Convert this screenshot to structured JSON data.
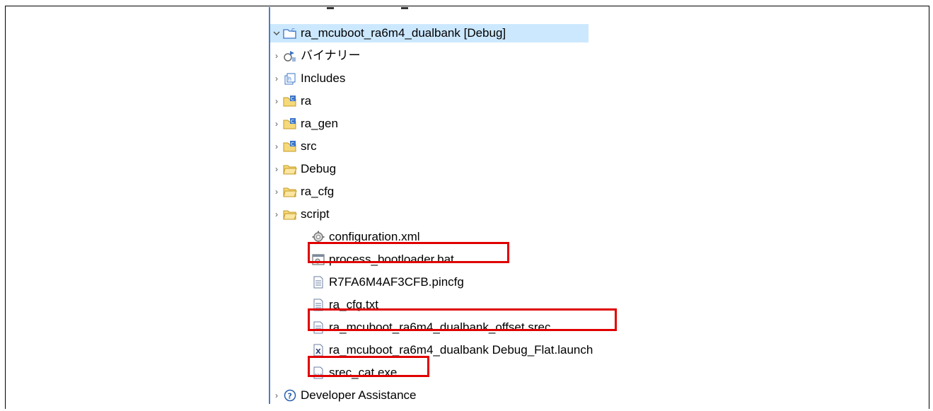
{
  "tree": {
    "root": {
      "label": "ra_mcuboot_ra6m4_dualbank [Debug]",
      "expanded": true,
      "icon": "project-folder-icon"
    },
    "items": [
      {
        "label": "バイナリー",
        "icon": "binaries-icon",
        "expandable": true
      },
      {
        "label": "Includes",
        "icon": "includes-icon",
        "expandable": true
      },
      {
        "label": "ra",
        "icon": "source-folder-icon",
        "expandable": true
      },
      {
        "label": "ra_gen",
        "icon": "source-folder-icon",
        "expandable": true
      },
      {
        "label": "src",
        "icon": "source-folder-icon",
        "expandable": true
      },
      {
        "label": "Debug",
        "icon": "folder-icon",
        "expandable": true
      },
      {
        "label": "ra_cfg",
        "icon": "folder-icon",
        "expandable": true
      },
      {
        "label": "script",
        "icon": "folder-icon",
        "expandable": true
      },
      {
        "label": "configuration.xml",
        "icon": "gear-file-icon",
        "expandable": false
      },
      {
        "label": "process_bootloader.bat",
        "icon": "batch-file-icon",
        "expandable": false,
        "highlighted": true
      },
      {
        "label": "R7FA6M4AF3CFB.pincfg",
        "icon": "text-file-icon",
        "expandable": false
      },
      {
        "label": "ra_cfg.txt",
        "icon": "text-file-icon",
        "expandable": false
      },
      {
        "label": "ra_mcuboot_ra6m4_dualbank_offset.srec",
        "icon": "text-file-icon",
        "expandable": false,
        "highlighted": true
      },
      {
        "label": "ra_mcuboot_ra6m4_dualbank Debug_Flat.launch",
        "icon": "launch-file-icon",
        "expandable": false
      },
      {
        "label": "srec_cat.exe",
        "icon": "binary-file-icon",
        "expandable": false,
        "highlighted": true
      },
      {
        "label": "Developer Assistance",
        "icon": "help-icon",
        "expandable": true
      }
    ]
  },
  "colors": {
    "highlight": "#e00000",
    "selection": "#cce8ff",
    "tree_line": "#4b7cc9"
  }
}
